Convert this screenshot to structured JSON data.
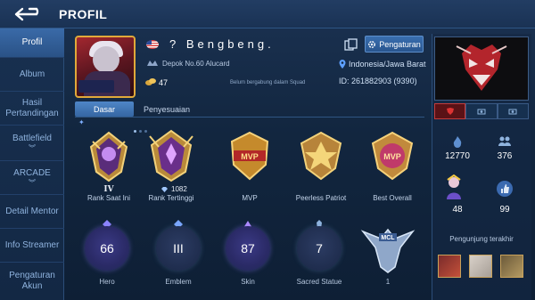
{
  "header": {
    "title": "PROFIL"
  },
  "sidebar": {
    "items": [
      {
        "label": "Profil"
      },
      {
        "label": "Album"
      },
      {
        "label": "Hasil Pertandingan"
      },
      {
        "label": "Battlefield"
      },
      {
        "label": "ARCADE"
      },
      {
        "label": "Detail Mentor"
      },
      {
        "label": "Info Streamer"
      },
      {
        "label": "Pengaturan Akun"
      }
    ]
  },
  "profile": {
    "username": "? Bengbeng.",
    "rank_location": "Depok No.60 Alucard",
    "coins": "47",
    "squad_note": "Belum bergabung dalam Squad",
    "region": "Indonesia/Jawa Barat",
    "player_id": "ID: 261882903 (9390)",
    "settings_label": "Pengaturan"
  },
  "tabs": [
    {
      "label": "Dasar"
    },
    {
      "label": "Penyesuaian"
    }
  ],
  "medals": [
    {
      "label": "Rank Saat Ini",
      "sub": "IV"
    },
    {
      "label": "Rank Tertinggi",
      "sub": "1082"
    },
    {
      "label": "MVP"
    },
    {
      "label": "Peerless Patriot"
    },
    {
      "label": "Best Overall"
    }
  ],
  "stats": [
    {
      "label": "Hero",
      "value": "66"
    },
    {
      "label": "Emblem",
      "value": "III"
    },
    {
      "label": "Skin",
      "value": "87"
    },
    {
      "label": "Sacred Statue",
      "value": "7"
    },
    {
      "label": "1",
      "value": ""
    }
  ],
  "right_panel": {
    "stat1": "12770",
    "stat2": "376",
    "stat3": "48",
    "stat4": "99",
    "visitors_title": "Pengunjung terakhir"
  },
  "colors": {
    "accent": "#3a6aa8",
    "gold": "#e0a93a",
    "purple": "#3b3a86"
  }
}
